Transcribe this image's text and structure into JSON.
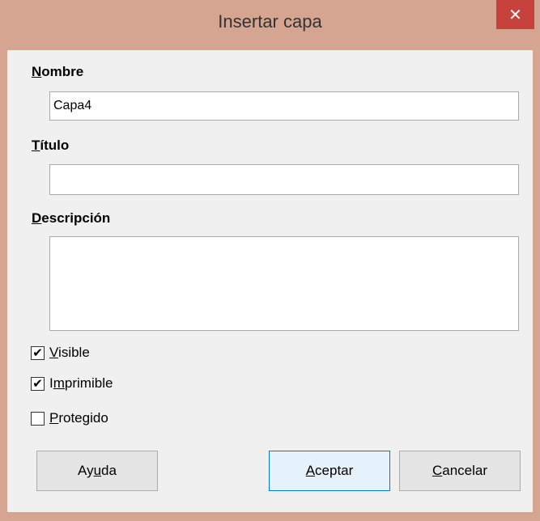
{
  "window": {
    "title": "Insertar capa",
    "close_icon": "close-icon"
  },
  "fields": {
    "nombre": {
      "label_first": "N",
      "label_rest": "ombre",
      "value": "Capa4"
    },
    "titulo": {
      "label_first": "T",
      "label_rest": "ítulo",
      "value": ""
    },
    "descripcion": {
      "label_first": "D",
      "label_rest": "escripción",
      "value": ""
    }
  },
  "checkboxes": [
    {
      "mn": "V",
      "rest": "isible",
      "checked": true
    },
    {
      "pre": "I",
      "mn": "m",
      "rest": "primible",
      "checked": true
    },
    {
      "mn": "P",
      "rest": "rotegido",
      "checked": false
    }
  ],
  "buttons": {
    "ayuda": {
      "pre": "Ay",
      "mn": "u",
      "rest": "da"
    },
    "aceptar": {
      "mn": "A",
      "rest": "ceptar"
    },
    "cancelar": {
      "mn": "C",
      "rest": "ancelar"
    }
  }
}
